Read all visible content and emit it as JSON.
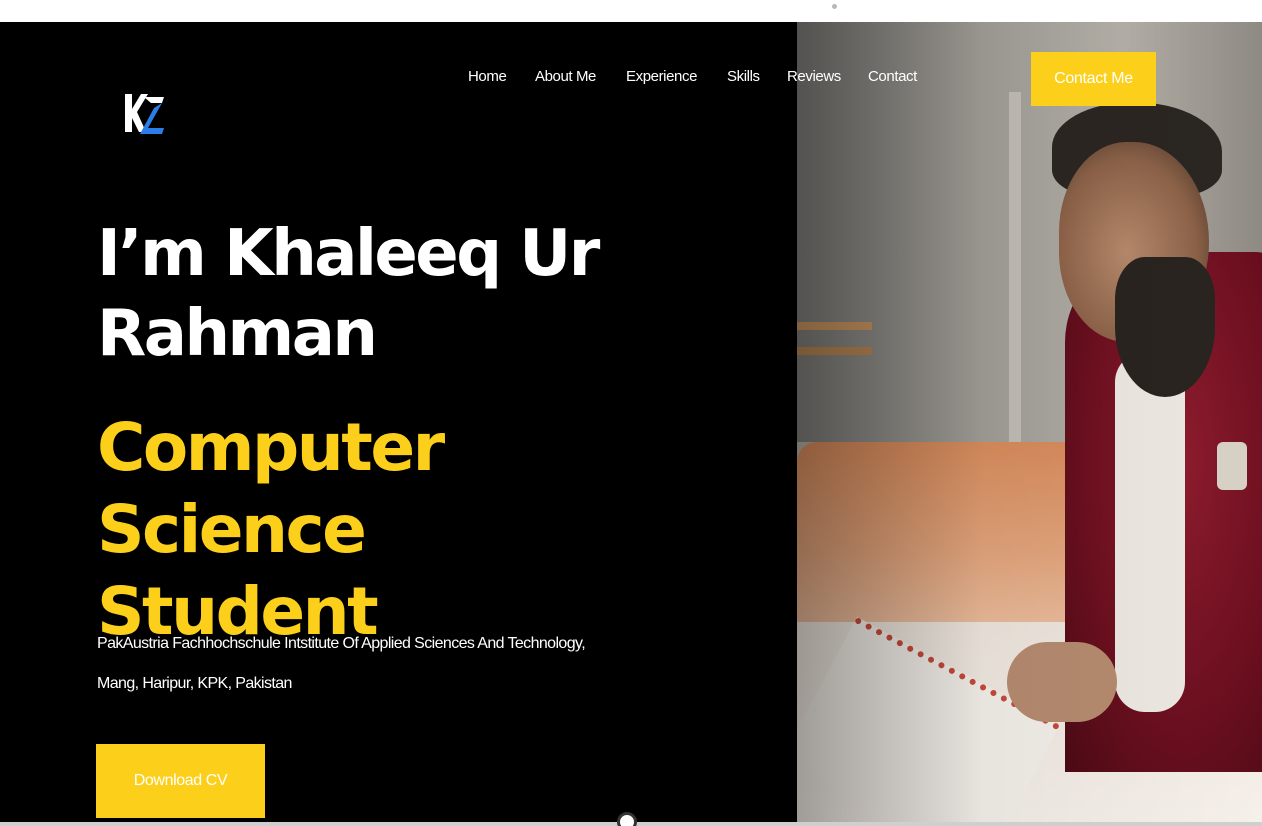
{
  "nav": {
    "items": [
      {
        "label": "Home"
      },
      {
        "label": "About Me"
      },
      {
        "label": "Experience"
      },
      {
        "label": "Skills"
      },
      {
        "label": "Reviews"
      },
      {
        "label": "Contact"
      }
    ],
    "contact_button": "Contact Me"
  },
  "logo": {
    "text": "KZ"
  },
  "hero": {
    "headline_line1": "I’m Khaleeq Ur",
    "headline_line2": "Rahman",
    "role_line1": "Computer Science",
    "role_line2": "Student",
    "institute_line1": "PakAustria Fachhochschule Intstitute Of Applied Sciences And Technology,",
    "institute_line2": "Mang, Haripur, KPK, Pakistan",
    "cv_button": "Download CV"
  },
  "colors": {
    "background": "#000000",
    "accent": "#fccf1a",
    "text": "#ffffff",
    "logo_blue": "#2b7de9"
  },
  "icons": {
    "logo": "kz-logo-icon",
    "scroll": "scroll-handle-icon"
  }
}
